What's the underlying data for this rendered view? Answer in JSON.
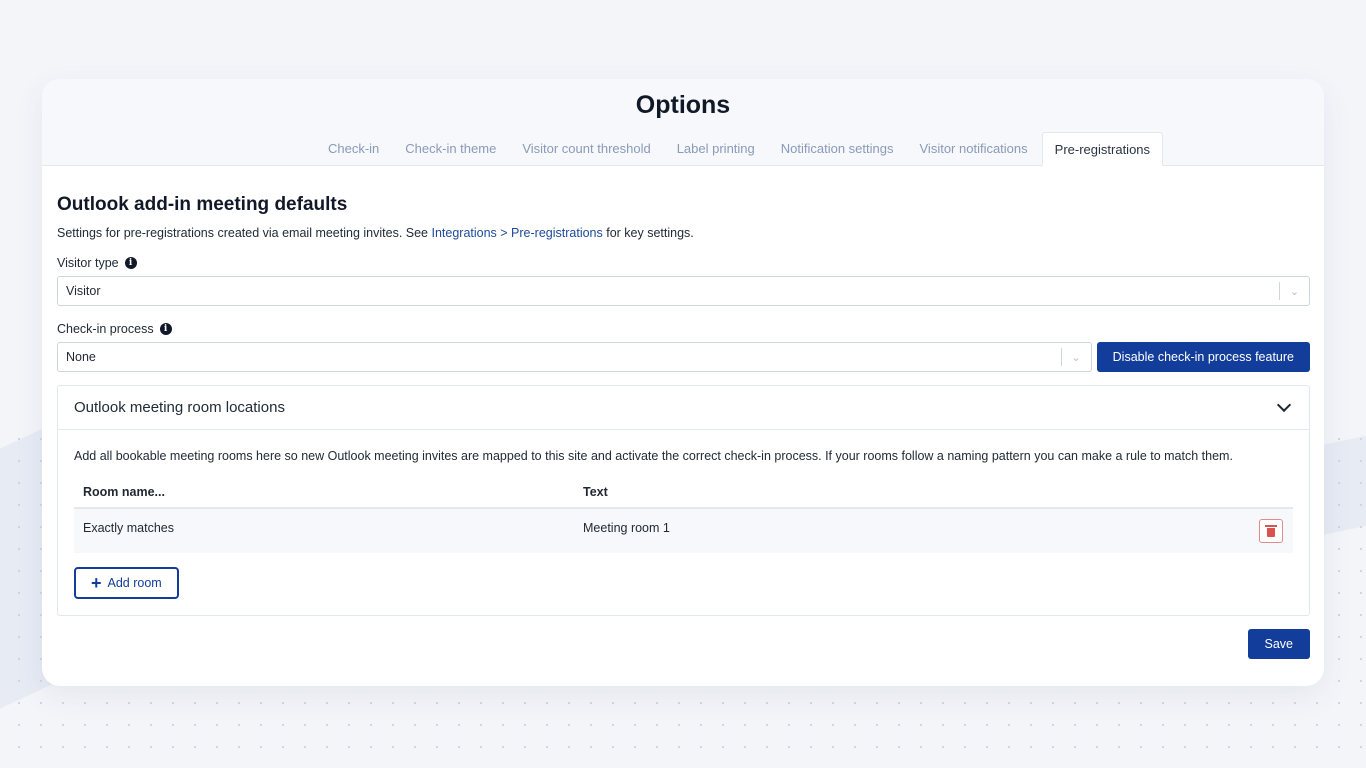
{
  "page": {
    "title": "Options"
  },
  "tabs": [
    {
      "label": "Check-in"
    },
    {
      "label": "Check-in theme"
    },
    {
      "label": "Visitor count threshold"
    },
    {
      "label": "Label printing"
    },
    {
      "label": "Notification settings"
    },
    {
      "label": "Visitor notifications"
    },
    {
      "label": "Pre-registrations",
      "active": true
    }
  ],
  "section": {
    "title": "Outlook add-in meeting defaults",
    "desc_prefix": "Settings for pre-registrations created via email meeting invites. See ",
    "desc_link": "Integrations > Pre-registrations",
    "desc_suffix": " for key settings."
  },
  "visitor_type": {
    "label": "Visitor type",
    "value": "Visitor"
  },
  "checkin_process": {
    "label": "Check-in process",
    "value": "None",
    "disable_button": "Disable check-in process feature"
  },
  "rooms_panel": {
    "title": "Outlook meeting room locations",
    "desc": "Add all bookable meeting rooms here so new Outlook meeting invites are mapped to this site and activate the correct check-in process. If your rooms follow a naming pattern you can make a rule to match them.",
    "columns": [
      "Room name...",
      "Text"
    ],
    "rows": [
      {
        "match": "Exactly matches",
        "text": "Meeting room 1"
      }
    ],
    "add_button": "Add room"
  },
  "actions": {
    "save": "Save"
  },
  "colors": {
    "primary": "#123d9a",
    "link": "#1d4a9a",
    "danger": "#d9534f"
  }
}
